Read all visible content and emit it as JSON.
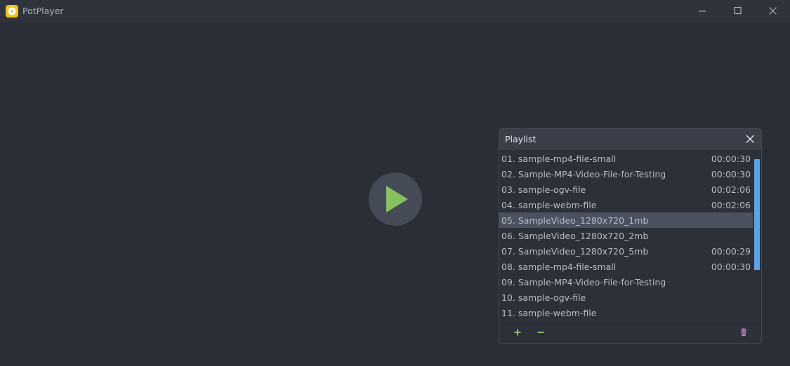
{
  "app": {
    "title": "PotPlayer",
    "logo_icon": "potplayer-logo-icon",
    "accent_color": "#f2c318"
  },
  "window_controls": {
    "minimize_icon": "minimize-icon",
    "maximize_icon": "maximize-icon",
    "close_icon": "close-icon"
  },
  "player": {
    "play_icon": "play-icon",
    "play_color": "#88c062"
  },
  "playlist": {
    "title": "Playlist",
    "close_icon": "close-icon",
    "items": [
      {
        "name": "01. sample-mp4-file-small",
        "duration": "00:00:30",
        "selected": false
      },
      {
        "name": "02. Sample-MP4-Video-File-for-Testing",
        "duration": "00:00:30",
        "selected": false
      },
      {
        "name": "03. sample-ogv-file",
        "duration": "00:02:06",
        "selected": false
      },
      {
        "name": "04. sample-webm-file",
        "duration": "00:02:06",
        "selected": false
      },
      {
        "name": "05. SampleVideo_1280x720_1mb",
        "duration": "",
        "selected": true
      },
      {
        "name": "06. SampleVideo_1280x720_2mb",
        "duration": "",
        "selected": false
      },
      {
        "name": "07. SampleVideo_1280x720_5mb",
        "duration": "00:00:29",
        "selected": false
      },
      {
        "name": "08. sample-mp4-file-small",
        "duration": "00:00:30",
        "selected": false
      },
      {
        "name": "09. Sample-MP4-Video-File-for-Testing",
        "duration": "",
        "selected": false
      },
      {
        "name": "10. sample-ogv-file",
        "duration": "",
        "selected": false
      },
      {
        "name": "11. sample-webm-file",
        "duration": "",
        "selected": false
      }
    ],
    "scroll_color": "#5aa5e8",
    "footer": {
      "add_icon": "plus-icon",
      "remove_icon": "minus-icon",
      "delete_icon": "trash-icon",
      "add_color": "#8fc46a",
      "delete_color": "#c07fd0"
    }
  }
}
